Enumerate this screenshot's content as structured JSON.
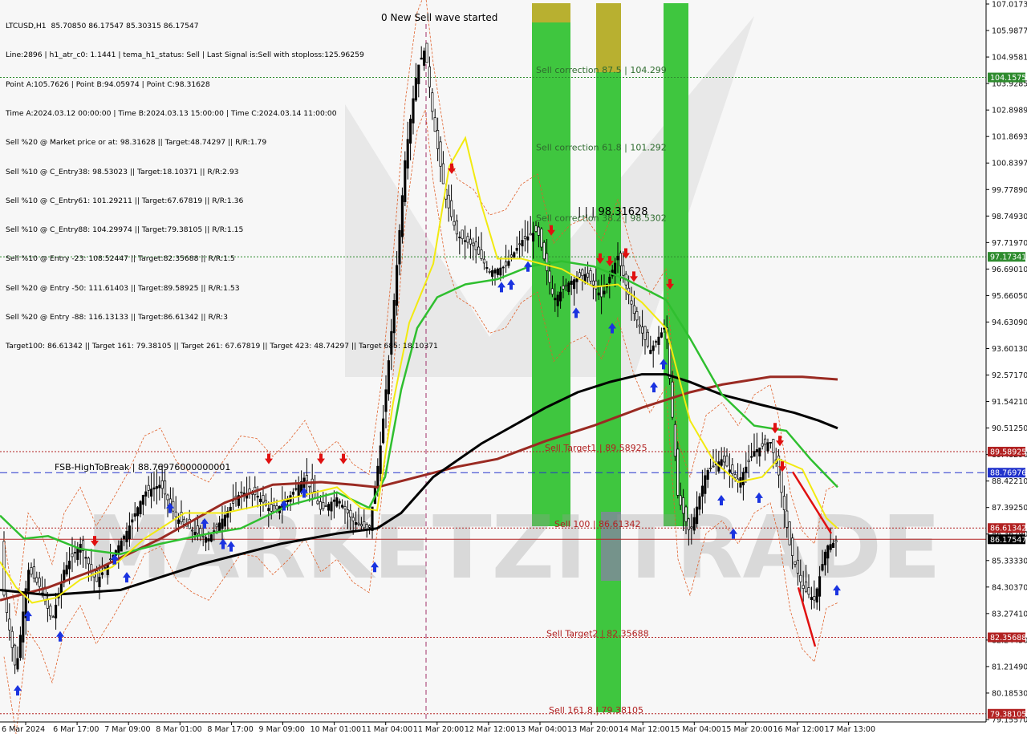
{
  "chart_data": {
    "type": "candlestick",
    "symbol_header": "LTCUSD,H1  85.70850 86.17547 85.30315 86.17547",
    "info_lines": [
      "Line:2896 | h1_atr_c0: 1.1441 | tema_h1_status: Sell | Last Signal is:Sell with stoploss:125.96259",
      "Point A:105.7626 | Point B:94.05974 | Point C:98.31628",
      "Time A:2024.03.12 00:00:00 | Time B:2024.03.13 15:00:00 | Time C:2024.03.14 11:00:00",
      "Sell %20 @ Market price or at: 98.31628 || Target:48.74297 || R/R:1.79",
      "Sell %10 @ C_Entry38: 98.53023 || Target:18.10371 || R/R:2.93",
      "Sell %10 @ C_Entry61: 101.29211 || Target:67.67819 || R/R:1.36",
      "Sell %10 @ C_Entry88: 104.29974 || Target:79.38105 || R/R:1.15",
      "Sell %10 @ Entry -23: 108.52447 || Target:82.35688 || R/R:1.5",
      "Sell %20 @ Entry -50: 111.61403 || Target:89.58925 || R/R:1.53",
      "Sell %20 @ Entry -88: 116.13133 || Target:86.61342 || R/R:3",
      "Target100: 86.61342 || Target 161: 79.38105 || Target 261: 67.67819 || Target 423: 48.74297 || Target 685: 18.10371"
    ],
    "y_axis": {
      "range": [
        79.1557,
        107.0173
      ],
      "ticks": [
        "107.01730",
        "105.98770",
        "104.95810",
        "103.92850",
        "102.89890",
        "101.86930",
        "100.83970",
        "99.77890",
        "98.74930",
        "97.71970",
        "96.69010",
        "95.66050",
        "94.63090",
        "93.60130",
        "92.57170",
        "91.54210",
        "90.51250",
        "89.48290",
        "88.42210",
        "87.39250",
        "86.36290",
        "85.33330",
        "84.30370",
        "83.27410",
        "82.24450",
        "81.21490",
        "80.18530",
        "79.15570"
      ]
    },
    "x_axis": {
      "labels": [
        "6 Mar 2024",
        "6 Mar 17:00",
        "7 Mar 09:00",
        "8 Mar 01:00",
        "8 Mar 17:00",
        "9 Mar 09:00",
        "10 Mar 01:00",
        "11 Mar 04:00",
        "11 Mar 20:00",
        "12 Mar 12:00",
        "13 Mar 04:00",
        "13 Mar 20:00",
        "14 Mar 12:00",
        "15 Mar 04:00",
        "15 Mar 20:00",
        "16 Mar 12:00",
        "17 Mar 13:00"
      ]
    },
    "price_badges": [
      {
        "value": "104.15752",
        "color": "#2e8b2e"
      },
      {
        "value": "97.17341",
        "color": "#2e8b2e"
      },
      {
        "value": "89.58925",
        "color": "#b22222"
      },
      {
        "value": "88.76976",
        "color": "#2233cc"
      },
      {
        "value": "86.61342",
        "color": "#b22222"
      },
      {
        "value": "86.17547",
        "color": "#000000"
      },
      {
        "value": "82.35688",
        "color": "#b22222"
      },
      {
        "value": "79.38105",
        "color": "#b22222"
      }
    ],
    "level_labels": [
      {
        "text": "Sell correction 87.5 | 104.299",
        "value": 104.299,
        "color": "#2e6b2e"
      },
      {
        "text": "Sell correction 61.8 | 101.292",
        "value": 101.292,
        "color": "#2e6b2e"
      },
      {
        "text": "Sell correction 38.2 | 98.5302",
        "value": 98.5302,
        "color": "#2e6b2e"
      },
      {
        "text": "Sell Target1 | 89.58925",
        "value": 89.58925,
        "color": "#b22222"
      },
      {
        "text": "Sell 100 | 86.61342",
        "value": 86.61342,
        "color": "#b22222"
      },
      {
        "text": "Sell Target2 | 82.35688",
        "value": 82.35688,
        "color": "#b22222"
      },
      {
        "text": "Sell 161.8 | 79.38105",
        "value": 79.38105,
        "color": "#b22222"
      },
      {
        "text": "FSB-HighToBreak | 88.76976000000001",
        "value": 88.76976,
        "color": "#000000"
      }
    ],
    "annotations": {
      "wave_text": "0 New Sell wave started",
      "point_c_text": "| | | 98.31628",
      "watermark": "MARKETZI TRADE"
    },
    "horizontal_levels": [
      {
        "value": 104.15752,
        "color": "#2e8b2e",
        "style": "dotted"
      },
      {
        "value": 97.17341,
        "color": "#2e8b2e",
        "style": "dotted"
      },
      {
        "value": 89.58925,
        "color": "#b22222",
        "style": "dotted"
      },
      {
        "value": 88.76976,
        "color": "#2233cc",
        "style": "dashed"
      },
      {
        "value": 86.61342,
        "color": "#b22222",
        "style": "dotted"
      },
      {
        "value": 86.17547,
        "color": "#b22222",
        "style": "solid"
      },
      {
        "value": 82.35688,
        "color": "#b22222",
        "style": "dotted"
      },
      {
        "value": 79.38105,
        "color": "#b22222",
        "style": "dotted"
      }
    ],
    "ma_black": [
      [
        0,
        84.2
      ],
      [
        60,
        84.0
      ],
      [
        150,
        84.2
      ],
      [
        250,
        85.2
      ],
      [
        350,
        86.0
      ],
      [
        420,
        86.4
      ],
      [
        470,
        86.6
      ],
      [
        500,
        87.2
      ],
      [
        540,
        88.6
      ],
      [
        600,
        89.9
      ],
      [
        640,
        90.6
      ],
      [
        680,
        91.3
      ],
      [
        720,
        91.9
      ],
      [
        760,
        92.3
      ],
      [
        800,
        92.6
      ],
      [
        830,
        92.6
      ],
      [
        860,
        92.3
      ],
      [
        900,
        91.8
      ],
      [
        950,
        91.4
      ],
      [
        990,
        91.1
      ],
      [
        1020,
        90.8
      ],
      [
        1044,
        90.5
      ]
    ],
    "ma_brown": [
      [
        0,
        83.8
      ],
      [
        60,
        84.3
      ],
      [
        120,
        85.0
      ],
      [
        200,
        86.2
      ],
      [
        280,
        87.6
      ],
      [
        340,
        88.3
      ],
      [
        400,
        88.4
      ],
      [
        440,
        88.3
      ],
      [
        470,
        88.2
      ],
      [
        520,
        88.6
      ],
      [
        570,
        89.0
      ],
      [
        620,
        89.3
      ],
      [
        680,
        90.0
      ],
      [
        740,
        90.6
      ],
      [
        800,
        91.3
      ],
      [
        860,
        91.9
      ],
      [
        900,
        92.2
      ],
      [
        960,
        92.5
      ],
      [
        1000,
        92.5
      ],
      [
        1044,
        92.4
      ]
    ],
    "ma_green": [
      [
        0,
        87.1
      ],
      [
        30,
        86.2
      ],
      [
        60,
        86.3
      ],
      [
        100,
        85.8
      ],
      [
        150,
        85.6
      ],
      [
        200,
        86.0
      ],
      [
        260,
        86.4
      ],
      [
        300,
        86.6
      ],
      [
        360,
        87.5
      ],
      [
        420,
        88.0
      ],
      [
        460,
        87.4
      ],
      [
        480,
        88.6
      ],
      [
        500,
        92.0
      ],
      [
        520,
        94.4
      ],
      [
        545,
        95.6
      ],
      [
        580,
        96.1
      ],
      [
        620,
        96.3
      ],
      [
        660,
        96.8
      ],
      [
        700,
        97.0
      ],
      [
        740,
        96.8
      ],
      [
        780,
        96.3
      ],
      [
        830,
        95.5
      ],
      [
        860,
        94.0
      ],
      [
        900,
        91.8
      ],
      [
        940,
        90.6
      ],
      [
        980,
        90.4
      ],
      [
        1010,
        89.3
      ],
      [
        1044,
        88.2
      ]
    ],
    "ma_yellow": [
      [
        0,
        85.3
      ],
      [
        20,
        84.3
      ],
      [
        40,
        83.7
      ],
      [
        70,
        83.9
      ],
      [
        100,
        84.6
      ],
      [
        140,
        85.1
      ],
      [
        180,
        86.2
      ],
      [
        230,
        87.2
      ],
      [
        280,
        87.2
      ],
      [
        340,
        87.6
      ],
      [
        380,
        87.9
      ],
      [
        420,
        88.2
      ],
      [
        450,
        87.4
      ],
      [
        470,
        87.3
      ],
      [
        490,
        91.5
      ],
      [
        510,
        94.6
      ],
      [
        540,
        96.9
      ],
      [
        560,
        100.7
      ],
      [
        580,
        101.8
      ],
      [
        600,
        99.2
      ],
      [
        620,
        97.1
      ],
      [
        650,
        97.1
      ],
      [
        700,
        96.7
      ],
      [
        740,
        96.0
      ],
      [
        770,
        96.1
      ],
      [
        800,
        95.4
      ],
      [
        830,
        94.4
      ],
      [
        860,
        90.8
      ],
      [
        890,
        89.2
      ],
      [
        920,
        88.4
      ],
      [
        950,
        88.6
      ],
      [
        970,
        89.3
      ],
      [
        1000,
        88.9
      ],
      [
        1030,
        87.0
      ],
      [
        1044,
        86.6
      ]
    ]
  }
}
